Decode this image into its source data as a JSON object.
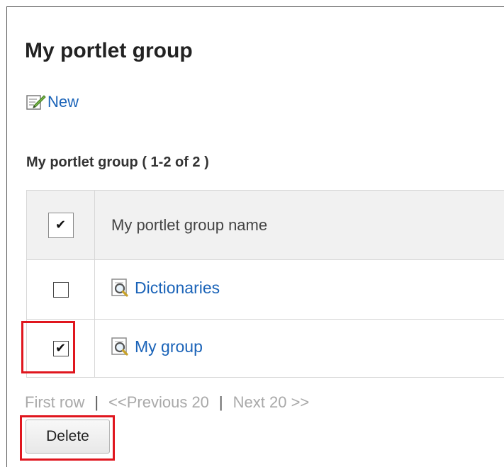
{
  "page": {
    "title": "My portlet group",
    "new_label": "New",
    "section_title": "My portlet group ( 1-2 of 2 )"
  },
  "table": {
    "header": {
      "select_all_checked": true,
      "column_name": "My portlet group name"
    },
    "rows": [
      {
        "name": "Dictionaries",
        "checked": false
      },
      {
        "name": "My group",
        "checked": true
      }
    ]
  },
  "pagination": {
    "first": "First row",
    "separator": "|",
    "previous": "<<Previous 20",
    "next": "Next 20 >>"
  },
  "actions": {
    "delete_label": "Delete"
  },
  "icons": {
    "new": "pencil-note-icon",
    "item": "magnifier-document-icon",
    "check": "✔"
  },
  "colors": {
    "link": "#1a63b8",
    "highlight": "#e0161e",
    "disabled_text": "#a9a9a9"
  }
}
